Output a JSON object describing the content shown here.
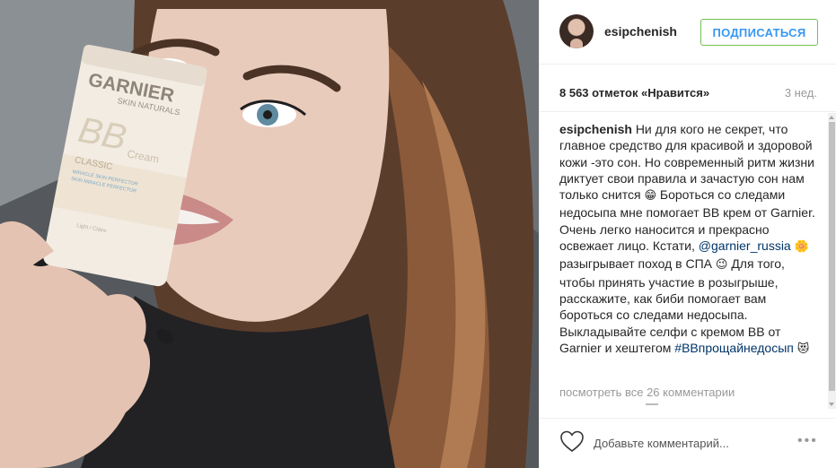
{
  "post": {
    "username": "esipchenish",
    "follow_label": "ПОДПИСАТЬСЯ",
    "likes": "8 563 отметок «Нравится»",
    "time": "3 нед.",
    "caption": {
      "author": "esipchenish",
      "part1": "Ни для кого не секрет, что главное средство для красивой и здоровой кожи -это сон. Но современный ритм жизни диктует свои правила и зачастую сон нам только снится",
      "emoji1": "😁",
      "part2": "Бороться со следами недосыпа мне помогает BB крем от Garnier. Очень легко наносится и прекрасно освежает лицо. Кстати,",
      "mention": "@garnier_russia",
      "emoji2": "🌼",
      "part3": "разыгрывает поход в СПА",
      "emoji3": "😉",
      "part4": "Для того, чтобы принять участие в розыгрыше, расскажите, как биби помогает вам бороться со следами недосыпа. Выкладывайте селфи с кремом BB от Garnier и хештегом",
      "hashtag": "#BBпрощайнедосып",
      "emoji4": "😻"
    },
    "view_all_comments": "посмотреть все 26 комментарии",
    "add_comment_placeholder": "Добавьте комментарий...",
    "more_label": "•••"
  },
  "photo": {
    "tube_brand": "GARNIER",
    "tube_sub": "SKIN NATURALS",
    "tube_product": "BB",
    "tube_cream": "Cream",
    "tube_classic": "CLASSIC",
    "tube_tag1": "MIRACLE SKIN PERFECTOR",
    "tube_tag2": "SKIN MIRACLE PERFECTOR",
    "tube_shade": "Light / Claire"
  },
  "colors": {
    "accent": "#3897f0",
    "follow_border": "#70c050",
    "link": "#003569"
  },
  "icons": {
    "heart": "heart-outline-icon",
    "more": "ellipsis-icon"
  }
}
